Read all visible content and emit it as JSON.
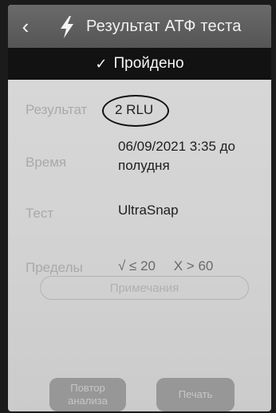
{
  "header": {
    "title": "Результат АТФ теста",
    "back_icon": "chevron-left-icon",
    "logo_icon": "lightning-bolt-icon"
  },
  "banner": {
    "check": "✓",
    "status": "Пройдено"
  },
  "fields": {
    "result_label": "Результат",
    "result_value": "2 RLU",
    "time_label": "Время",
    "time_value": "06/09/2021 3:35 до полудня",
    "test_label": "Тест",
    "test_value": "UltraSnap",
    "limits_label": "Пределы",
    "limit_pass": "√ ≤ 20",
    "limit_fail": "X > 60"
  },
  "buttons": {
    "notes": "Примечания",
    "repeat": "Повтор анализа",
    "print": "Печать"
  },
  "colors": {
    "header_bg": "#5f5f5f",
    "banner_bg": "#121212",
    "screen_bg": "#d6d6d6"
  }
}
